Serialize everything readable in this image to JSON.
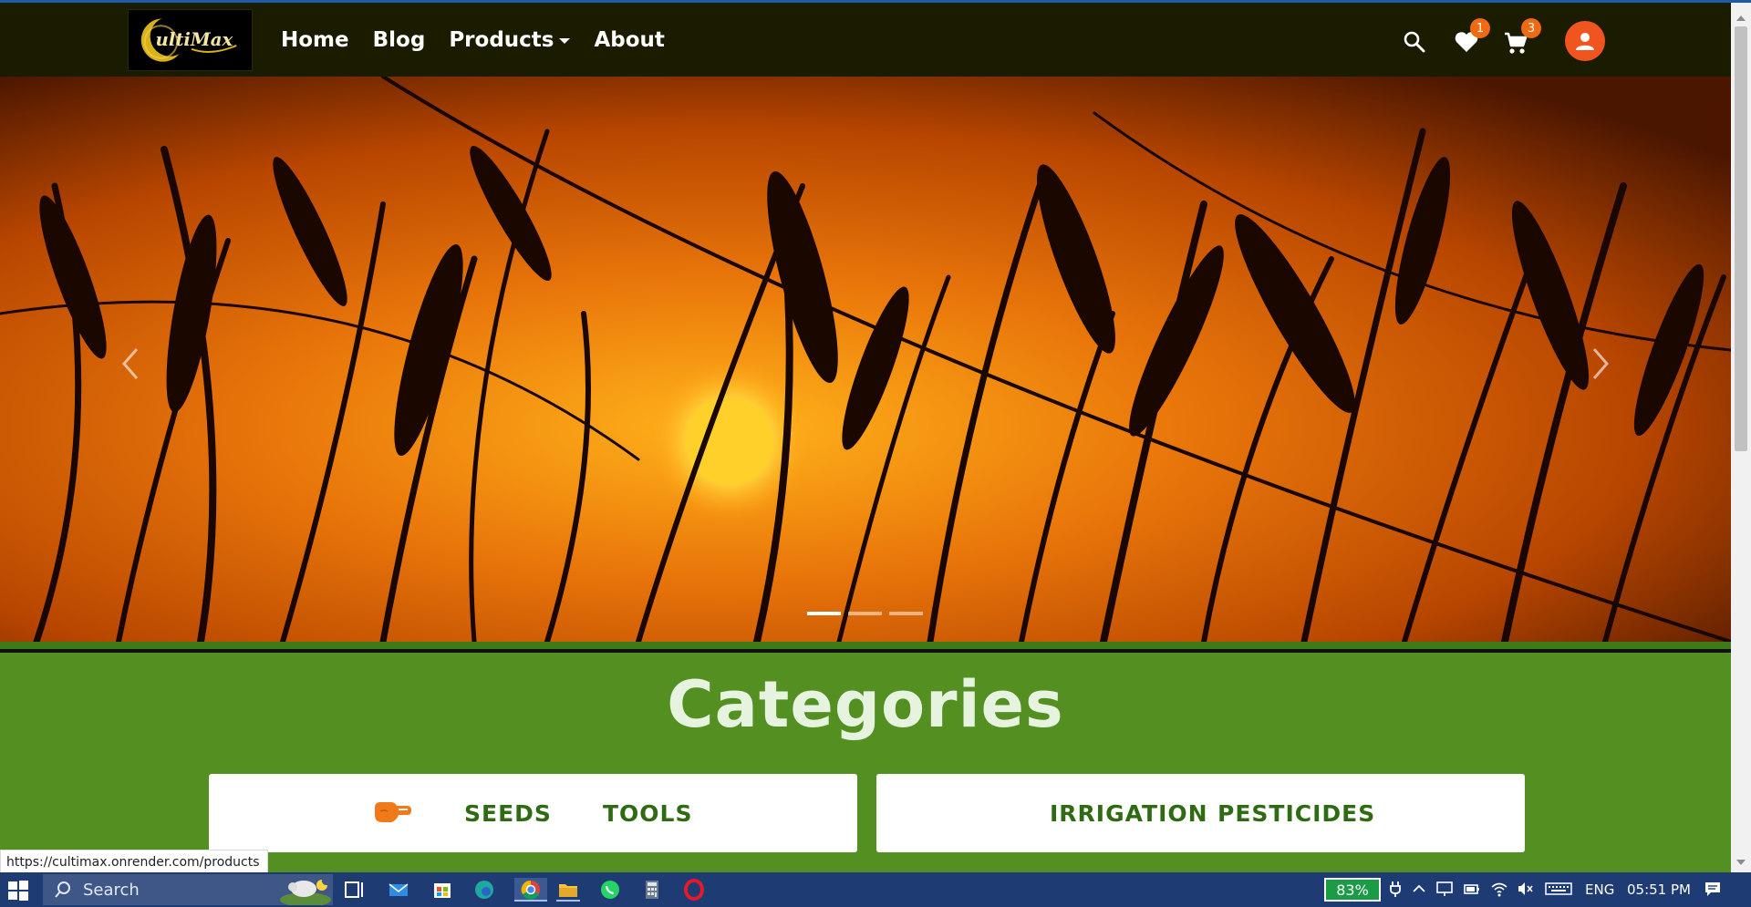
{
  "browser": {
    "status_url": "https://cultimax.onrender.com/products"
  },
  "navbar": {
    "brand_text": "ultiMax",
    "links": [
      {
        "label": "Home"
      },
      {
        "label": "Blog"
      },
      {
        "label": "Products"
      },
      {
        "label": "About"
      }
    ],
    "wishlist_count": "1",
    "cart_count": "3",
    "background": "#1b1b00",
    "accent": "#f06a12"
  },
  "hero": {
    "slide_count": 3,
    "active_slide": 1
  },
  "categories": {
    "title": "Categories",
    "left_card": [
      "SEEDS",
      "TOOLS"
    ],
    "right_card": [
      "IRRIGATION",
      "PESTICIDES"
    ],
    "section_color": "#548f22",
    "link_color": "#2f6b13"
  },
  "taskbar": {
    "search_label": "Search",
    "battery": "83%",
    "language": "ENG",
    "clock": "05:51 PM",
    "apps": [
      "task-view",
      "mail",
      "store",
      "edge",
      "chrome",
      "file-explorer",
      "whatsapp",
      "calculator",
      "opera"
    ]
  }
}
